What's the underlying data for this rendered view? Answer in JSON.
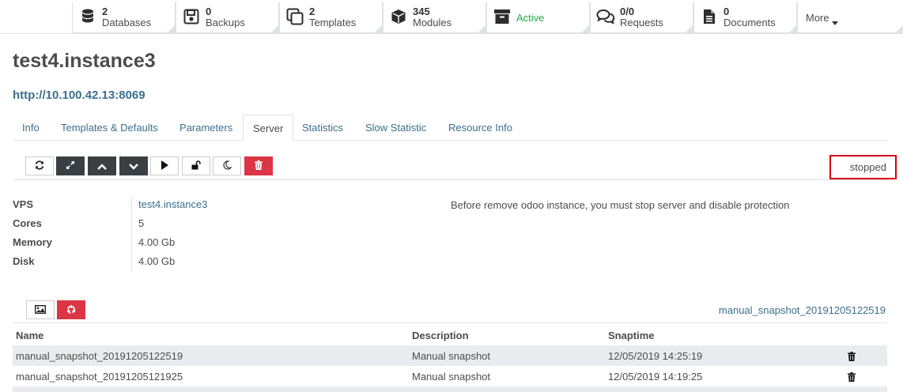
{
  "stat_buttons": [
    {
      "number": "2",
      "label": "Databases",
      "icon": "database-icon"
    },
    {
      "number": "0",
      "label": "Backups",
      "icon": "save-icon"
    },
    {
      "number": "2",
      "label": "Templates",
      "icon": "clone-icon"
    },
    {
      "number": "345",
      "label": "Modules",
      "icon": "cube-icon"
    },
    {
      "label": "Active",
      "icon": "archive-icon",
      "color": "#28a745"
    },
    {
      "number": "0/0",
      "label": "Requests",
      "icon": "comments-icon"
    },
    {
      "number": "0",
      "label": "Documents",
      "icon": "file-text-icon"
    },
    {
      "label": "More",
      "icon": "caret-down-icon"
    }
  ],
  "record": {
    "title": "test4.instance3",
    "url": "http://10.100.42.13:8069"
  },
  "tabs": [
    "Info",
    "Templates & Defaults",
    "Parameters",
    "Server",
    "Statistics",
    "Slow Statistic",
    "Resource Info"
  ],
  "active_tab": "Server",
  "toolbar": {
    "buttons": [
      "refresh-icon",
      "expand-icon",
      "chevron-up-icon",
      "chevron-down-icon",
      "play-icon",
      "unlock-icon",
      "moon-icon",
      "trash-icon"
    ],
    "status": "stopped"
  },
  "info": {
    "vps_label": "VPS",
    "vps_value": "test4.instance3",
    "cores_label": "Cores",
    "cores_value": "5",
    "memory_label": "Memory",
    "memory_value": "4.00 Gb",
    "disk_label": "Disk",
    "disk_value": "4.00 Gb",
    "warning": "Before remove odoo instance, you must stop server and disable protection"
  },
  "snapshots": {
    "current": "manual_snapshot_20191205122519",
    "columns": [
      "Name",
      "Description",
      "Snaptime"
    ],
    "rows": [
      {
        "name": "manual_snapshot_20191205122519",
        "description": "Manual snapshot",
        "snaptime": "12/05/2019 14:25:19"
      },
      {
        "name": "manual_snapshot_20191205121925",
        "description": "Manual snapshot",
        "snaptime": "12/05/2019 14:19:25"
      }
    ]
  },
  "colors": {
    "link": "#3c6f8c",
    "active_green": "#28a745",
    "danger": "#dc3545",
    "dark_button": "#3a3f44",
    "status_highlight": "#d9000d"
  }
}
